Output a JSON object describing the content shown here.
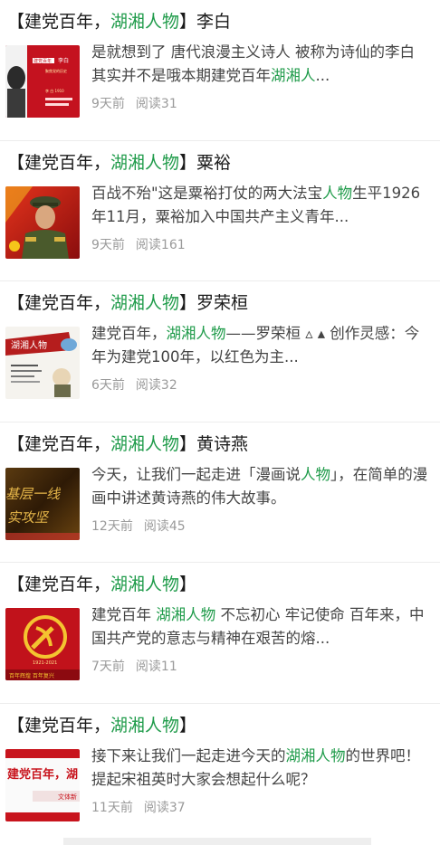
{
  "items": [
    {
      "title_prefix": "【建党百年，",
      "title_hl": "湖湘人物",
      "title_suffix": "】李白",
      "summary_parts": [
        "是就想到了 唐代浪漫主义诗人 被称为诗仙的李白 其实并不是哦本期建党百年",
        "湖湘人",
        "..."
      ],
      "time": "9天前",
      "reads": "阅读31",
      "thumb": {
        "kind": "poster-libai",
        "texts": [
          "建党百年",
          "李白",
          "聚焦党的历史",
          "李 白 1910"
        ]
      }
    },
    {
      "title_prefix": "【建党百年，",
      "title_hl": "湖湘人物",
      "title_suffix": "】粟裕",
      "summary_parts": [
        "百战不殆\"这是粟裕打仗的两大法宝",
        "人物",
        "生平1926年11月，粟裕加入中国共产主义青年..."
      ],
      "time": "9天前",
      "reads": "阅读161",
      "thumb": {
        "kind": "portrait-suyu"
      }
    },
    {
      "title_prefix": "【建党百年，",
      "title_hl": "湖湘人物",
      "title_suffix": "】罗荣桓",
      "summary_parts": [
        "建党百年，",
        "湖湘人物",
        "——罗荣桓 ▵ ▴ 创作灵感：今年为建党100年，以红色为主..."
      ],
      "time": "6天前",
      "reads": "阅读32",
      "thumb": {
        "kind": "comic-luo",
        "texts": [
          "湖湘人物"
        ]
      }
    },
    {
      "title_prefix": "【建党百年，",
      "title_hl": "湖湘人物",
      "title_suffix": "】黄诗燕",
      "summary_parts": [
        "今天，让我们一起走进「漫画说",
        "人物",
        "」，在简单的漫画中讲述黄诗燕的伟大故事。"
      ],
      "time": "12天前",
      "reads": "阅读45",
      "thumb": {
        "kind": "gold-calligraphy",
        "texts": [
          "基层一线",
          "实攻坚"
        ]
      }
    },
    {
      "title_prefix": "【建党百年，",
      "title_hl": "湖湘人物",
      "title_suffix": "】",
      "summary_parts": [
        "建党百年 ",
        "湖湘人物",
        " 不忘初心 牢记使命 百年来，中国共产党的意志与精神在艰苦的熔..."
      ],
      "time": "7天前",
      "reads": "阅读11",
      "thumb": {
        "kind": "party-emblem",
        "texts": [
          "1921-2021",
          "百年辉煌 百年复兴"
        ]
      }
    },
    {
      "title_prefix": "【建党百年，",
      "title_hl": "湖湘人物",
      "title_suffix": "】",
      "summary_parts": [
        "接下来让我们一起走进今天的",
        "湖湘人物",
        "的世界吧！提起宋祖英时大家会想起什么呢？"
      ],
      "time": "11天前",
      "reads": "阅读37",
      "thumb": {
        "kind": "red-banner",
        "texts": [
          "建党百年，湖",
          "文体新"
        ]
      }
    }
  ]
}
